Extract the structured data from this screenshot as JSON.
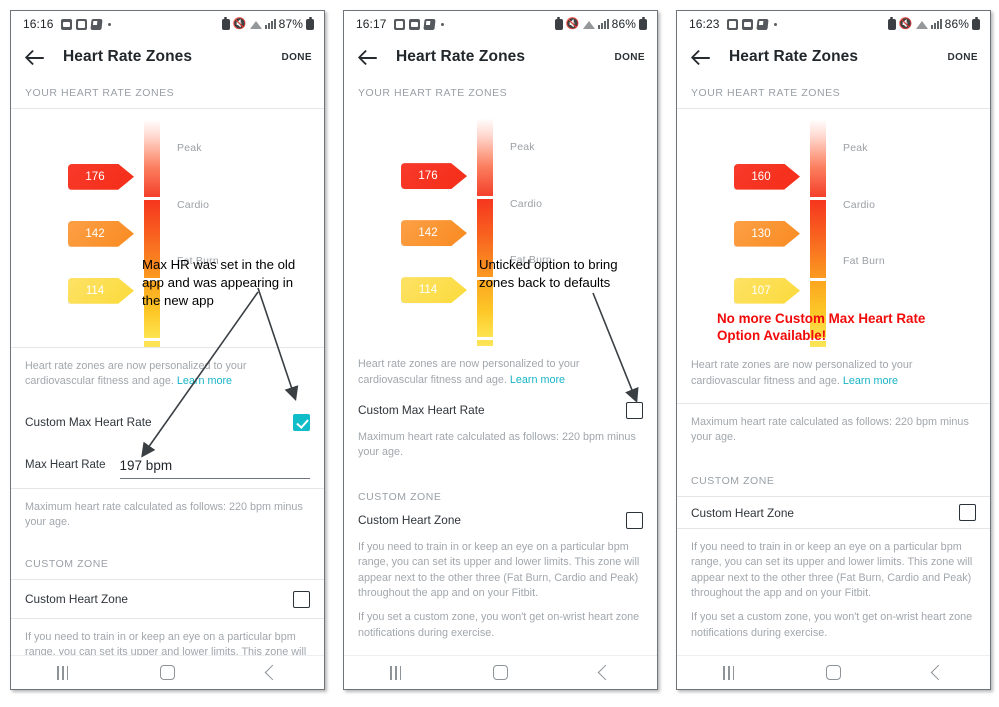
{
  "panels": [
    {
      "id": "panel-1",
      "status": {
        "time": "16:16",
        "battery": "87%",
        "icons": [
          "mail-icon",
          "gallery-icon",
          "app-icon",
          "dot-icon"
        ],
        "right_icons": [
          "battery-saver-icon",
          "mute-icon",
          "wifi-icon",
          "signal-icon"
        ]
      },
      "appbar": {
        "title": "Heart Rate Zones",
        "action": "DONE",
        "back": "back-arrow"
      },
      "section_header": "YOUR HEART RATE ZONES",
      "zones": {
        "names": [
          "Peak",
          "Cardio",
          "Fat Burn"
        ],
        "tags": [
          "176",
          "142",
          "114"
        ]
      },
      "personalized_note": "Heart rate zones are now personalized to your cardiovascular fitness and age.",
      "learn_more": "Learn more",
      "custom_max_hr": {
        "label": "Custom Max Heart Rate",
        "checked": true
      },
      "max_hr_field": {
        "label": "Max Heart Rate",
        "value": "197 bpm"
      },
      "max_hr_note": "Maximum heart rate calculated as follows: 220 bpm minus your age.",
      "custom_zone_header": "CUSTOM ZONE",
      "custom_heart_zone": {
        "label": "Custom Heart Zone",
        "checked": false
      },
      "custom_zone_note_1": "If you need to train in or keep an eye on a particular bpm range, you can set its upper and lower limits. This zone will appear next to the other three (Fat Burn, Cardio and Peak) throughout the app and on your Fitbit.",
      "custom_zone_note_2": "",
      "annotation": "Max HR was set in the old\napp and was appearing in\nthe new app",
      "annotation_color": "#000000"
    },
    {
      "id": "panel-2",
      "status": {
        "time": "16:17",
        "battery": "86%",
        "icons": [
          "gallery-icon",
          "mail-icon",
          "app-icon",
          "dot-icon"
        ],
        "right_icons": [
          "battery-saver-icon",
          "mute-icon",
          "wifi-icon",
          "signal-icon"
        ]
      },
      "appbar": {
        "title": "Heart Rate Zones",
        "action": "DONE",
        "back": "back-arrow"
      },
      "section_header": "YOUR HEART RATE ZONES",
      "zones": {
        "names": [
          "Peak",
          "Cardio",
          "Fat Burn"
        ],
        "tags": [
          "176",
          "142",
          "114"
        ]
      },
      "personalized_note": "Heart rate zones are now personalized to your cardiovascular fitness and age.",
      "learn_more": "Learn more",
      "custom_max_hr": {
        "label": "Custom Max Heart Rate",
        "checked": false
      },
      "max_hr_note": "Maximum heart rate calculated as follows: 220 bpm minus your age.",
      "custom_zone_header": "CUSTOM ZONE",
      "custom_heart_zone": {
        "label": "Custom Heart Zone",
        "checked": false
      },
      "custom_zone_note_1": "If you need to train in or keep an eye on a particular bpm range, you can set its upper and lower limits. This zone will appear next to the other three (Fat Burn, Cardio and Peak) throughout the app and on your Fitbit.",
      "custom_zone_note_2": "If you set a custom zone, you won't get on-wrist heart zone notifications during exercise.",
      "annotation": "Unticked option to bring\nzones back to defaults",
      "annotation_color": "#000000"
    },
    {
      "id": "panel-3",
      "status": {
        "time": "16:23",
        "battery": "86%",
        "icons": [
          "gallery-icon",
          "mail-icon",
          "app-icon",
          "dot-icon"
        ],
        "right_icons": [
          "battery-saver-icon",
          "mute-icon",
          "wifi-icon",
          "signal-icon"
        ]
      },
      "appbar": {
        "title": "Heart Rate Zones",
        "action": "DONE",
        "back": "back-arrow"
      },
      "section_header": "YOUR HEART RATE ZONES",
      "zones": {
        "names": [
          "Peak",
          "Cardio",
          "Fat Burn"
        ],
        "tags": [
          "160",
          "130",
          "107"
        ]
      },
      "personalized_note": "Heart rate zones are now personalized to your cardiovascular fitness and age.",
      "learn_more": "Learn more",
      "max_hr_note": "Maximum heart rate calculated as follows: 220 bpm minus your age.",
      "custom_zone_header": "CUSTOM ZONE",
      "custom_heart_zone": {
        "label": "Custom Heart Zone",
        "checked": false
      },
      "custom_zone_note_1": "If you need to train in or keep an eye on a particular bpm range, you can set its upper and lower limits. This zone will appear next to the other three (Fat Burn, Cardio and Peak) throughout the app and on your Fitbit.",
      "custom_zone_note_2": "If you set a custom zone, you won't get on-wrist heart zone notifications during exercise.",
      "annotation": "No more Custom Max Heart Rate\nOption Available!",
      "annotation_color": "#f10a0a"
    }
  ],
  "colors": {
    "accent_teal": "#0fbcc8",
    "link_teal": "#18b4c6",
    "peak": "#f4402b",
    "cardio": "#f98a20",
    "fat_burn": "#fbda3b",
    "annotation_red": "#f10a0a"
  },
  "navbar": {
    "recent": "recent-apps-icon",
    "home": "home-icon",
    "back": "back-icon"
  }
}
